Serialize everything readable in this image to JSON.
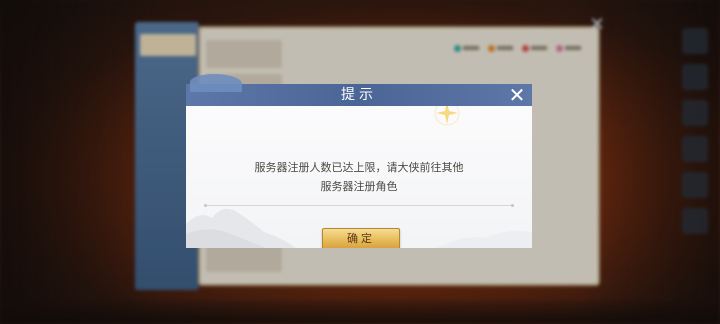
{
  "dialog": {
    "title": "提示",
    "message_line1": "服务器注册人数已达上限，请大侠前往其他",
    "message_line2": "服务器注册角色",
    "confirm_label": "确定",
    "close_icon": "close-icon"
  },
  "colors": {
    "header_blue": "#4a6596",
    "button_gold": "#e7bb5b",
    "legend_teal": "#3aa99f",
    "legend_orange": "#e58a2e",
    "legend_red": "#d9534f",
    "legend_pink": "#d67aa0"
  }
}
